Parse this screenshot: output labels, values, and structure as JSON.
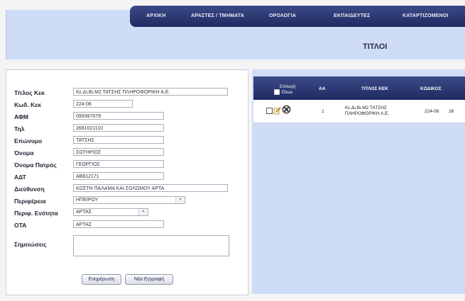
{
  "nav": {
    "items": [
      "ΑΡΧΙΚΗ",
      "ΑΡΑΣΤΕΣ / ΤΜΗΜΑΤΑ",
      "ΟΡΟΛΟΓΙΑ",
      "ΕΚΠΑΙΔΕΥΤΕΣ",
      "ΚΑΤΑΡΤΙΖΟΜΕΝΟΙ"
    ]
  },
  "page": {
    "title": "ΤΙΤΛΟΙ"
  },
  "form": {
    "labels": {
      "title": "Τίτλος Κεκ",
      "code": "Κωδ. Κεκ",
      "afm": "ΑΦΜ",
      "phone": "Τηλ",
      "surname": "Επώνυμο",
      "name": "Όνομα",
      "father": "Όνομα Πατρός",
      "adt": "ΑΔΤ",
      "address": "Διεύθυνση",
      "region": "Περιφέρεια",
      "unit": "Περιφ. Ενότητα",
      "ota": "ΟΤΑ",
      "notes": "Σημειώσεις"
    },
    "values": {
      "title": "Κε.Δι.Βι.Μ2 ΤΑΤΣΗΣ ΠΛΗΡΟΦΟΡΙΚΗ Α.Ε.",
      "code": "224-06",
      "afm": "099387079",
      "phone": "2681021110",
      "surname": "ΤΑΤΣΗΣ",
      "name": "ΣΩΤΗΡΙΟΣ",
      "father": "ΓΕΩΡΓΙΟΣ",
      "adt": "ΑΒ812171",
      "address": "ΚΩΣΤΗ ΠΑΛΑΜΑ ΚΑΙ ΣΟΛΩΜΟΥ ΑΡΤΑ",
      "region": "ΗΠΕΙΡΟΥ",
      "unit": "ΑΡΤΑΣ",
      "ota": "ΑΡΤΑΣ"
    },
    "buttons": {
      "update": "Ενημέρωση",
      "new": "Νέα Εγγραφή"
    }
  },
  "table": {
    "headers": {
      "select_line1": "Επιλογή",
      "select_line2": "Όλων",
      "aa": "ΑΑ",
      "title": "ΤΙΤΛΟΣ ΚΕΚ",
      "code": "ΚΩΔΙΚΟΣ"
    },
    "rows": [
      {
        "aa": "1",
        "title_line1": "Κε.Δι.Βι.Μ2 ΤΑΤΣΗΣ",
        "title_line2": "ΠΛΗΡΟΦΟΡΙΚΗ Α.Ε.",
        "code": "224-06",
        "extra": "26"
      }
    ]
  }
}
